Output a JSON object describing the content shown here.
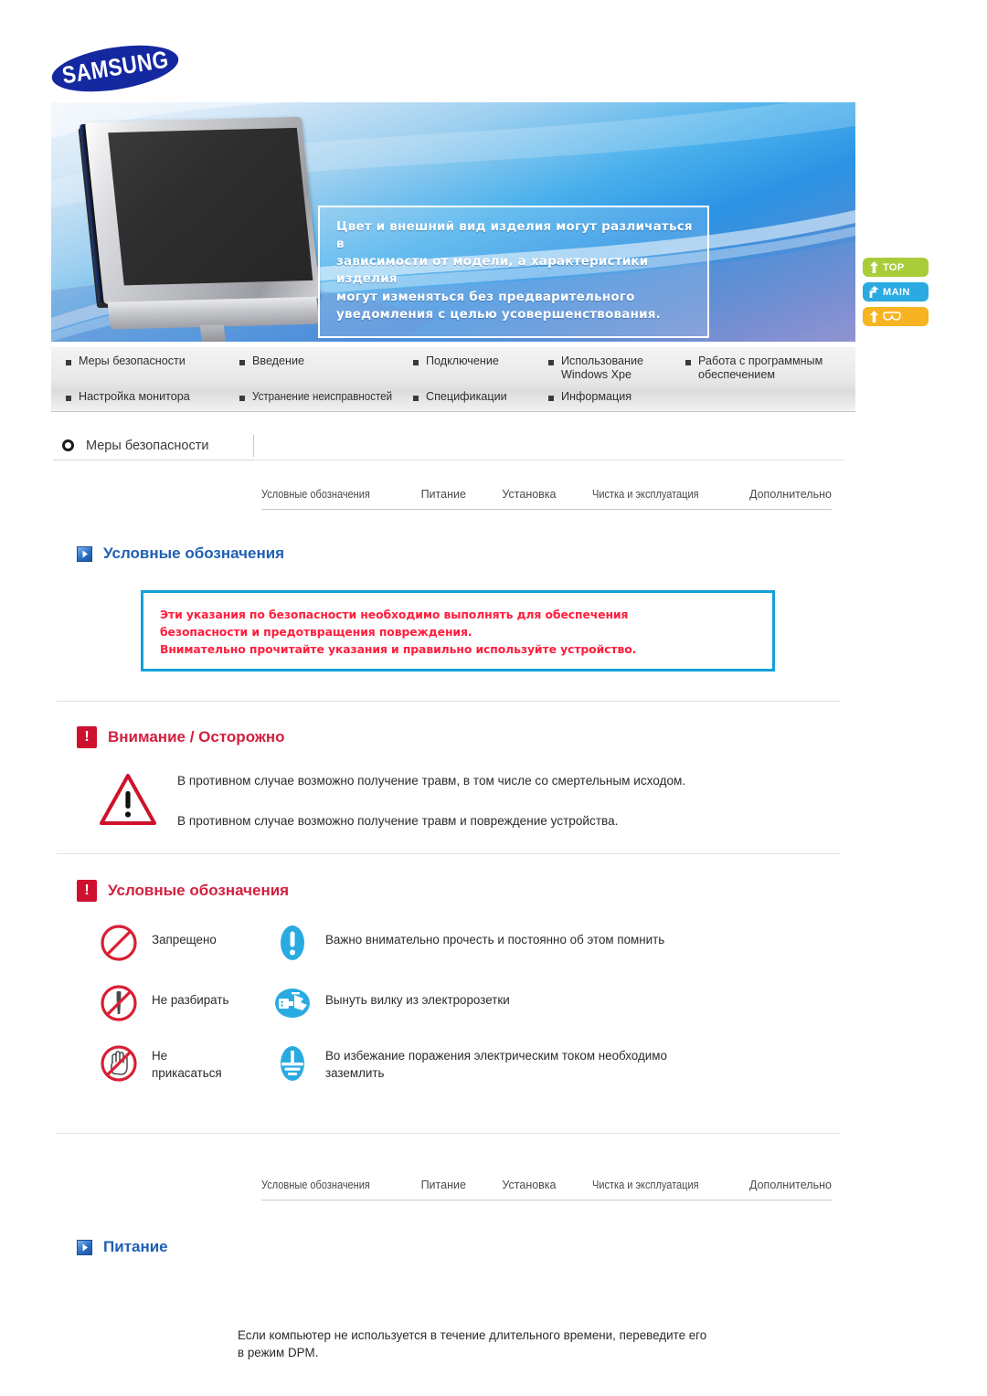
{
  "brand": {
    "logo_text": "SAMSUNG"
  },
  "banner": {
    "callout_lines": [
      "Цвет и внешний вид изделия могут различаться в",
      "зависимости от модели, а характеристики изделия",
      "могут изменяться без предварительного",
      "уведомления с целью усовершенствования."
    ],
    "monitor_icon": "lcd-monitor-illustration"
  },
  "side_buttons": [
    {
      "label": "TOP",
      "icon": "arrow-up-icon",
      "color": "#a8cd39"
    },
    {
      "label": "MAIN",
      "icon": "arrow-turn-icon",
      "color": "#2aaae1"
    },
    {
      "label": "",
      "icon": "arrow-up-glasses-icon",
      "color": "#f6b322"
    }
  ],
  "nav": {
    "row1": [
      "Меры безопасности",
      "Введение",
      "Подключение",
      "Использование\nWindows Xpe",
      "Работа с программным\nобеспечением"
    ],
    "row2": [
      "Настройка монитора",
      "Устранение неисправностей",
      "Спецификации",
      "Информация"
    ]
  },
  "section": {
    "title": "Меры безопасности",
    "marker_icon": "ring-bullet-icon"
  },
  "tabs": [
    "Условные обозначения",
    "Питание",
    "Установка",
    "Чистка и эксплуатация",
    "Дополнительно"
  ],
  "headings": {
    "symbols_blue": "Условные обозначения",
    "caution_red": "Внимание / Осторожно",
    "symbols_red": "Условные обозначения",
    "power_blue": "Питание"
  },
  "notice": {
    "lines": [
      "Эти указания по безопасности необходимо выполнять для обеспечения",
      "безопасности и предотвращения повреждения.",
      "Внимательно прочитайте указания и правильно используйте устройство."
    ],
    "border_color": "#13a0dc",
    "text_color": "#ff1d3c"
  },
  "caution": {
    "icon": "warning-triangle-icon",
    "lines": [
      "В противном случае возможно получение травм, в том числе со смертельным исходом.",
      "В противном случае возможно получение травм и повреждение устройства."
    ]
  },
  "legend_rows": [
    {
      "left": {
        "icon": "prohibition-circle-icon",
        "text": "Запрещено"
      },
      "right": {
        "icon": "blue-exclamation-icon",
        "text": "Важно внимательно прочесть и постоянно об этом помнить"
      }
    },
    {
      "left": {
        "icon": "no-disassemble-icon",
        "text": "Не разбирать"
      },
      "right": {
        "icon": "unplug-hand-icon",
        "text": "Вынуть вилку из электророзетки"
      }
    },
    {
      "left": {
        "icon": "no-touch-hand-icon",
        "text": "Не\nприкасаться"
      },
      "right": {
        "icon": "earth-ground-icon",
        "text": "Во избежание поражения электрическим током необходимо\nзаземлить"
      }
    }
  ],
  "power": {
    "paragraph": "Если компьютер не используется в течение длительного времени, переведите его\nв режим DPM."
  },
  "colors": {
    "samsung_blue": "#1428a0",
    "heading_blue": "#1f5fb4",
    "heading_red": "#d31f3f",
    "notice_red": "#ff1d3c",
    "notice_border": "#13a0dc",
    "legend_blue": "#29abe2",
    "legend_red": "#d81f34"
  }
}
